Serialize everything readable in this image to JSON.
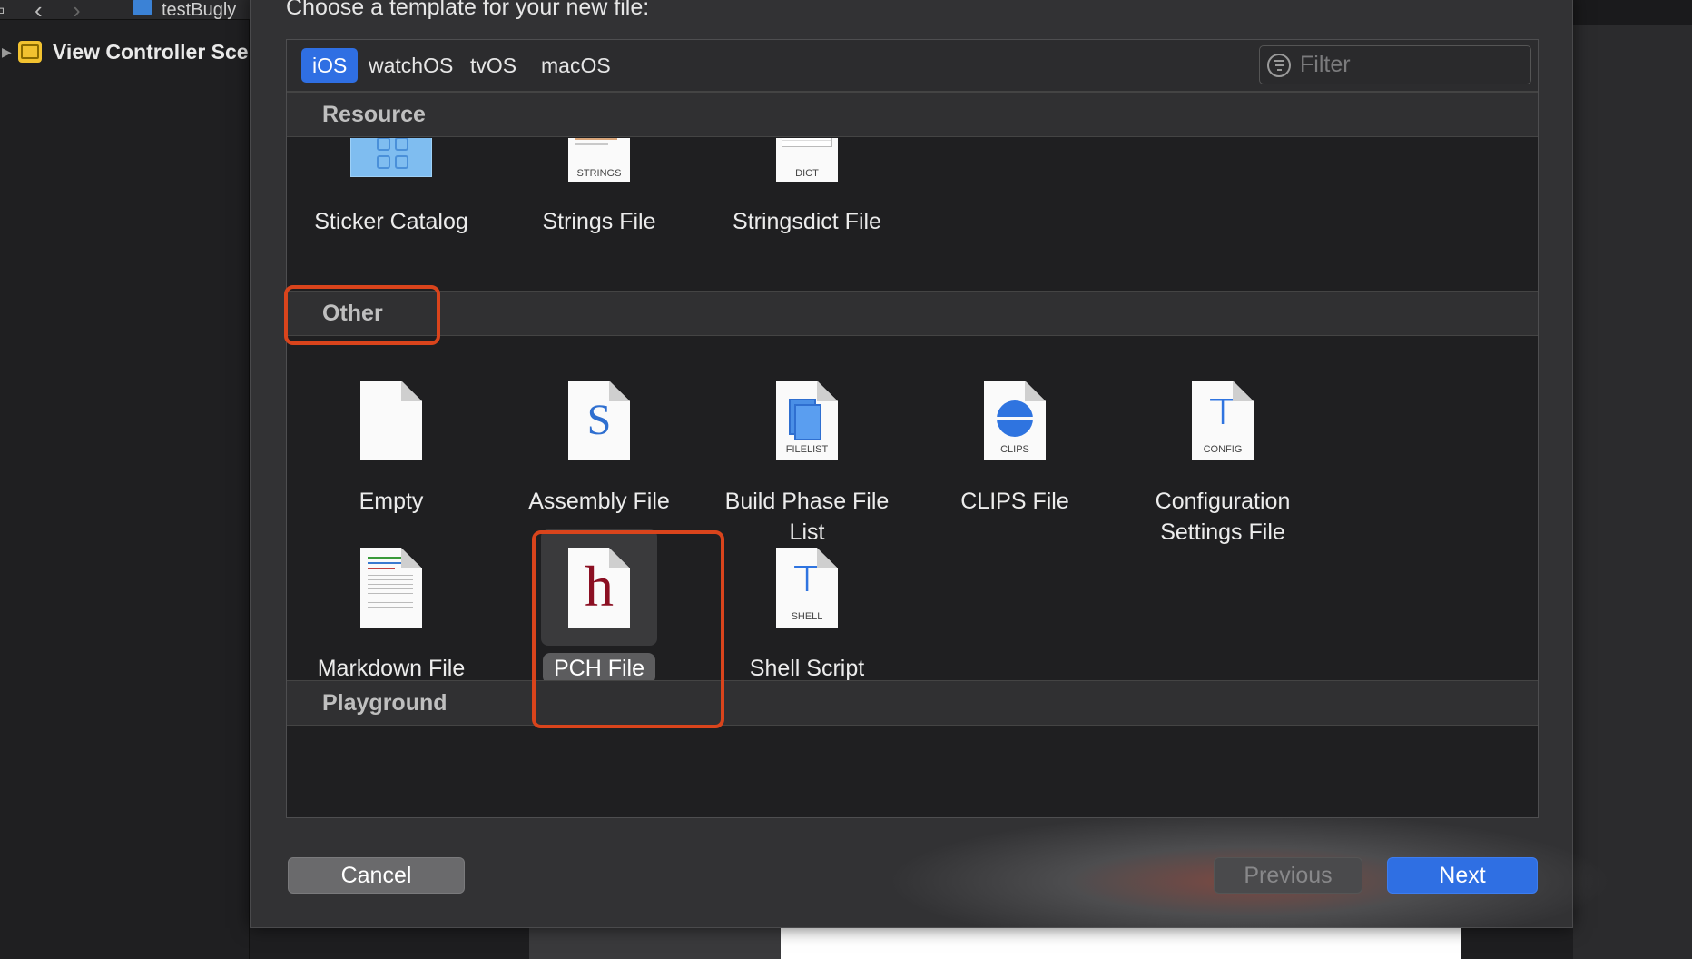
{
  "background": {
    "window_title": "testBugly",
    "scene_label": "View Controller Sce"
  },
  "dialog": {
    "title": "Choose a template for your new file:",
    "tabs": [
      "iOS",
      "watchOS",
      "tvOS",
      "macOS"
    ],
    "active_tab": "iOS",
    "filter_placeholder": "Filter",
    "sections": {
      "resource": {
        "title": "Resource",
        "items": [
          {
            "label": "Sticker Catalog",
            "icon": "sticker-catalog-icon"
          },
          {
            "label": "Strings File",
            "icon": "strings-file-icon",
            "caption": "STRINGS"
          },
          {
            "label": "Stringsdict File",
            "icon": "stringsdict-file-icon",
            "caption": "DICT"
          }
        ]
      },
      "other": {
        "title": "Other",
        "items": [
          {
            "label": "Empty",
            "icon": "empty-file-icon"
          },
          {
            "label": "Assembly File",
            "icon": "assembly-file-icon",
            "glyph": "S"
          },
          {
            "label": "Build Phase File List",
            "icon": "filelist-icon",
            "caption": "FILELIST"
          },
          {
            "label": "CLIPS File",
            "icon": "clips-file-icon",
            "caption": "CLIPS"
          },
          {
            "label": "Configuration Settings File",
            "icon": "config-file-icon",
            "caption": "CONFIG"
          },
          {
            "label": "Markdown File",
            "icon": "markdown-file-icon"
          },
          {
            "label": "PCH File",
            "icon": "pch-file-icon",
            "glyph": "h",
            "selected": true
          },
          {
            "label": "Shell Script",
            "icon": "shell-script-icon",
            "caption": "SHELL"
          }
        ]
      },
      "playground": {
        "title": "Playground"
      }
    },
    "buttons": {
      "cancel": "Cancel",
      "previous": "Previous",
      "next": "Next"
    },
    "colors": {
      "accent": "#2f6fe3",
      "highlight": "#d9441c",
      "pch_glyph": "#8b0f22"
    }
  }
}
